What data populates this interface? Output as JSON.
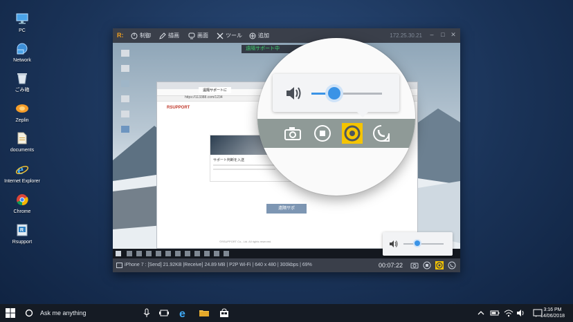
{
  "desktop": {
    "icons": [
      {
        "label": "PC",
        "icon": "pc-icon"
      },
      {
        "label": "Network",
        "icon": "network-icon"
      },
      {
        "label": "ごみ箱",
        "icon": "recycle-bin-icon"
      },
      {
        "label": "Zeplin",
        "icon": "zeplin-icon"
      },
      {
        "label": "documents",
        "icon": "documents-icon"
      },
      {
        "label": "Internet Explorer",
        "icon": "internet-explorer-icon"
      },
      {
        "label": "Chrome",
        "icon": "chrome-icon"
      },
      {
        "label": "Rsupport",
        "icon": "rsupport-icon"
      }
    ]
  },
  "window": {
    "menu": {
      "control": "制御",
      "draw": "描画",
      "screen": "画面",
      "tools": "ツール",
      "add": "追加"
    },
    "ip": "172.25.30.21",
    "remote_banner": "遠隔サポート中",
    "status": {
      "device_info": "iPhone 7 : [Send] 21.92KB  |Receive] 24.89 MB | P2P Wi-Fi | 640 x 480 | 300kbps | 69%",
      "elapsed": "00:07:22"
    }
  },
  "remote_page": {
    "tab": "遠隔サポートに",
    "url": "https://113388.com/1234",
    "brand": "RSUPPORT",
    "card_title": "サポート判断を入送",
    "connect_button": "遠隔サポ",
    "footer": "©RSUPPORT Co., Ltd. All rights reserved."
  },
  "zoom": {
    "volume_level": 0.3,
    "icons": [
      "camera-icon",
      "stop-icon",
      "speaker-icon",
      "call-icon"
    ],
    "accent": "#f5c400"
  },
  "mini_volume": {
    "volume_level": 0.35
  },
  "taskbar": {
    "search_placeholder": "Ask me anything",
    "time": "3:16 PM",
    "date": "14/06/2018"
  }
}
